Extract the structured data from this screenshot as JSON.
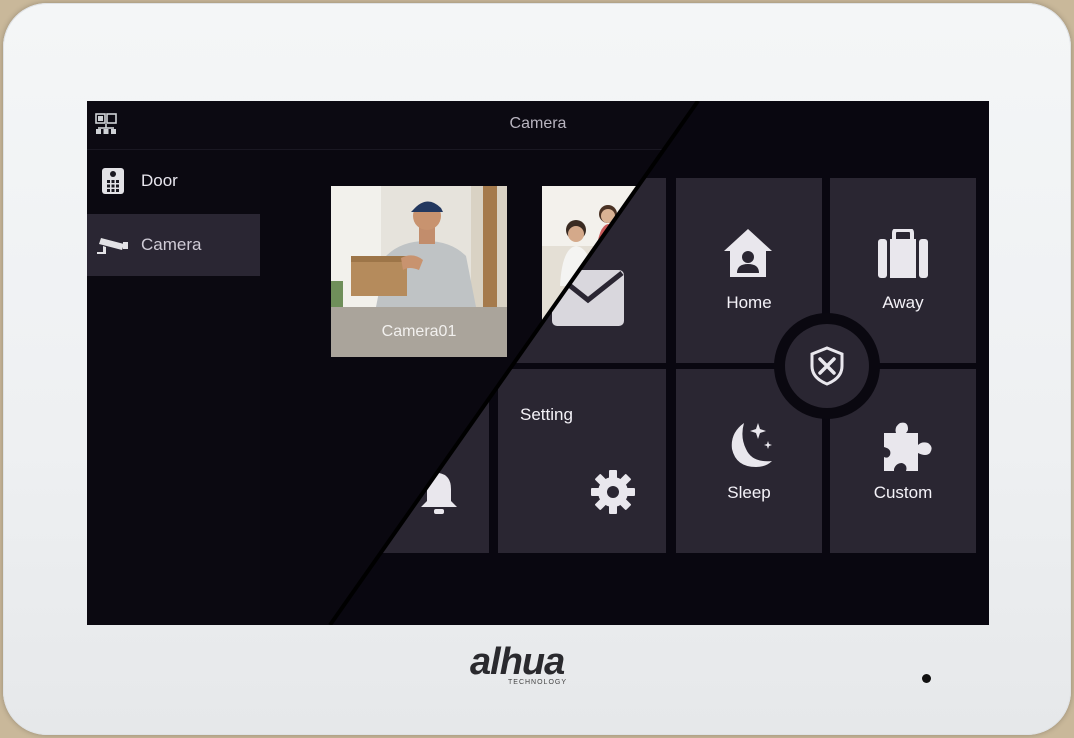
{
  "header": {
    "title": "Camera"
  },
  "sidebar": {
    "items": [
      {
        "label": "Door",
        "icon": "door-station-icon",
        "active": false
      },
      {
        "label": "Camera",
        "icon": "cctv-camera-icon",
        "active": true
      }
    ]
  },
  "cameras": [
    {
      "label": "Camera01"
    }
  ],
  "home": {
    "tiles": {
      "setting": "Setting",
      "home": "Home",
      "away": "Away",
      "sleep": "Sleep",
      "custom": "Custom"
    }
  },
  "device": {
    "brand": "alhua",
    "brand_sub": "TECHNOLOGY"
  },
  "colors": {
    "screen_bg": "#0a0810",
    "tile_bg": "#2a2632",
    "active_sidebar": "#2a2633",
    "camera_label_bg": "#aaa49b",
    "bezel": "#eef0f2"
  }
}
